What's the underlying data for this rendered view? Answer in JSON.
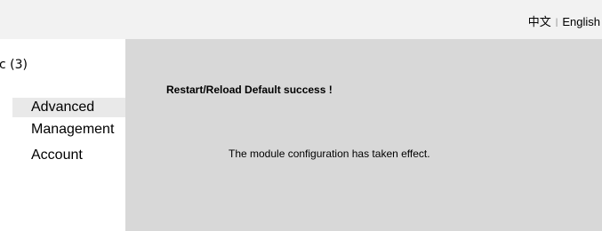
{
  "header": {
    "lang_chinese": "中文",
    "lang_separator": "|",
    "lang_english": "English"
  },
  "sidebar": {
    "header": "c (3)",
    "items": [
      {
        "label": "Advanced",
        "active": true
      },
      {
        "label": "Management",
        "active": false
      },
      {
        "label": "Account",
        "active": false
      }
    ]
  },
  "main": {
    "title": "Restart/Reload Default success !",
    "message": "The module configuration has taken effect."
  },
  "colors": {
    "topbar_bg": "#f2f2f2",
    "content_bg": "#d8d8d8",
    "active_item_bg": "#e9e9e9"
  }
}
